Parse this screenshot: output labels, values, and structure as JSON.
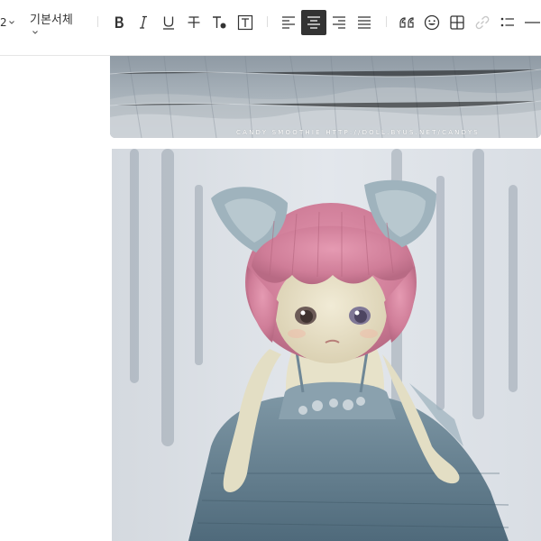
{
  "toolbar": {
    "font_size_value": "2",
    "font_family_label": "기본서체",
    "buttons": [
      {
        "id": "bold",
        "icon": "bold-icon"
      },
      {
        "id": "italic",
        "icon": "italic-icon"
      },
      {
        "id": "underline",
        "icon": "underline-icon"
      },
      {
        "id": "strikethrough",
        "icon": "strikethrough-icon"
      },
      {
        "id": "text-color",
        "icon": "text-color-icon"
      },
      {
        "id": "text-background",
        "icon": "text-background-icon"
      },
      {
        "id": "align-left",
        "icon": "align-left-icon"
      },
      {
        "id": "align-center",
        "icon": "align-center-icon",
        "active": true
      },
      {
        "id": "align-right",
        "icon": "align-right-icon"
      },
      {
        "id": "align-justify",
        "icon": "align-justify-icon"
      },
      {
        "id": "quote",
        "icon": "quote-icon"
      },
      {
        "id": "emoticon",
        "icon": "emoticon-icon"
      },
      {
        "id": "table",
        "icon": "table-icon"
      },
      {
        "id": "link",
        "icon": "link-icon",
        "disabled": true
      },
      {
        "id": "bullet-list",
        "icon": "bullet-list-icon"
      },
      {
        "id": "horizontal-line",
        "icon": "horizontal-line-icon"
      }
    ],
    "active_color": "#333333",
    "icon_color": "#333333",
    "disabled_color": "#c8c8c8"
  },
  "content": {
    "watermark_text": "CANDY SMOOTHIE HTTP://DOLL.BYUS.NET/CANDYS"
  }
}
